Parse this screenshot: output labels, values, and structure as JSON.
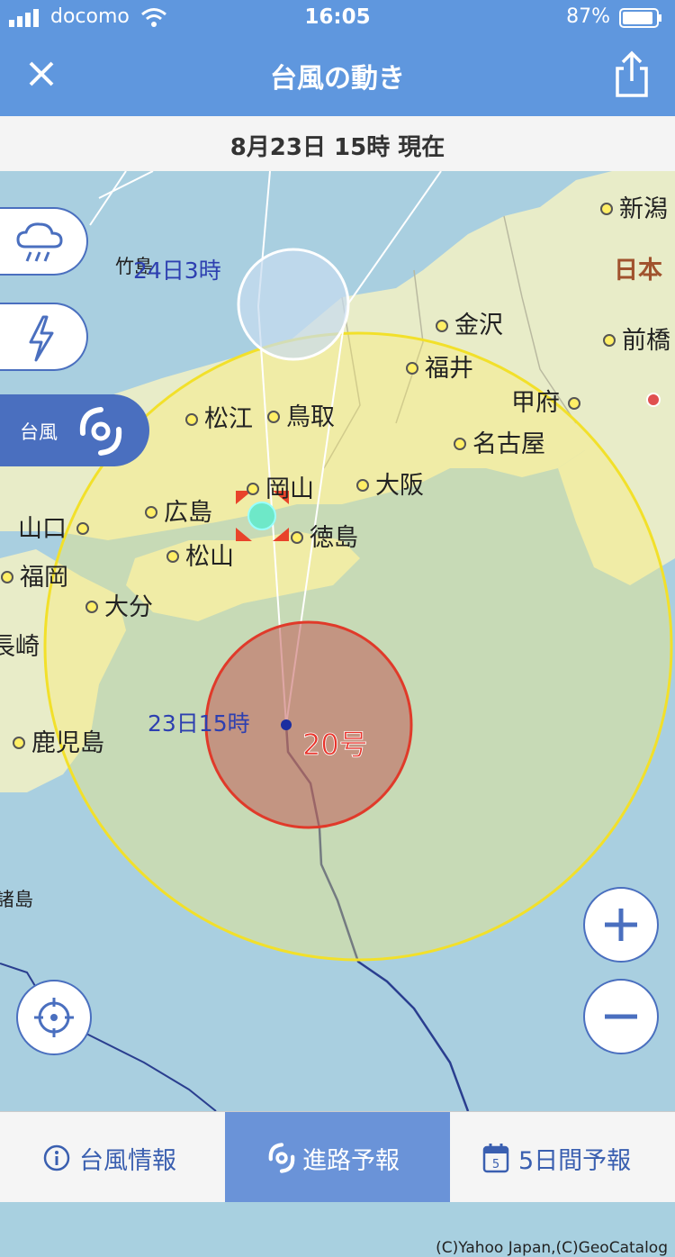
{
  "status": {
    "carrier": "docomo",
    "time": "16:05",
    "battery": "87%"
  },
  "nav": {
    "title": "台風の動き"
  },
  "datebar": {
    "date": "8月23日 15時 現在"
  },
  "sidebar": {
    "active_label": "台風"
  },
  "map": {
    "cities": [
      "新潟",
      "金沢",
      "前橋",
      "福井",
      "甲府",
      "松江",
      "鳥取",
      "名古屋",
      "岡山",
      "大阪",
      "広島",
      "山口",
      "徳島",
      "松山",
      "福岡",
      "大分",
      "長崎",
      "鹿児島",
      "日本",
      "竹島",
      "諸島"
    ],
    "forecast_time_label": "24日3時",
    "current_time_label": "23日15時",
    "typhoon_number": "20号",
    "copyright": "(C)Yahoo Japan,(C)GeoCatalog"
  },
  "tabs": [
    {
      "label": "台風情報",
      "icon": "info-icon"
    },
    {
      "label": "進路予報",
      "icon": "typhoon-icon"
    },
    {
      "label": "5日間予報",
      "icon": "calendar-icon"
    }
  ],
  "colors": {
    "header": "#5f97de",
    "accent": "#4a6fbf",
    "storm_zone": "#ffef66",
    "typhoon_core": "#c0504d"
  }
}
